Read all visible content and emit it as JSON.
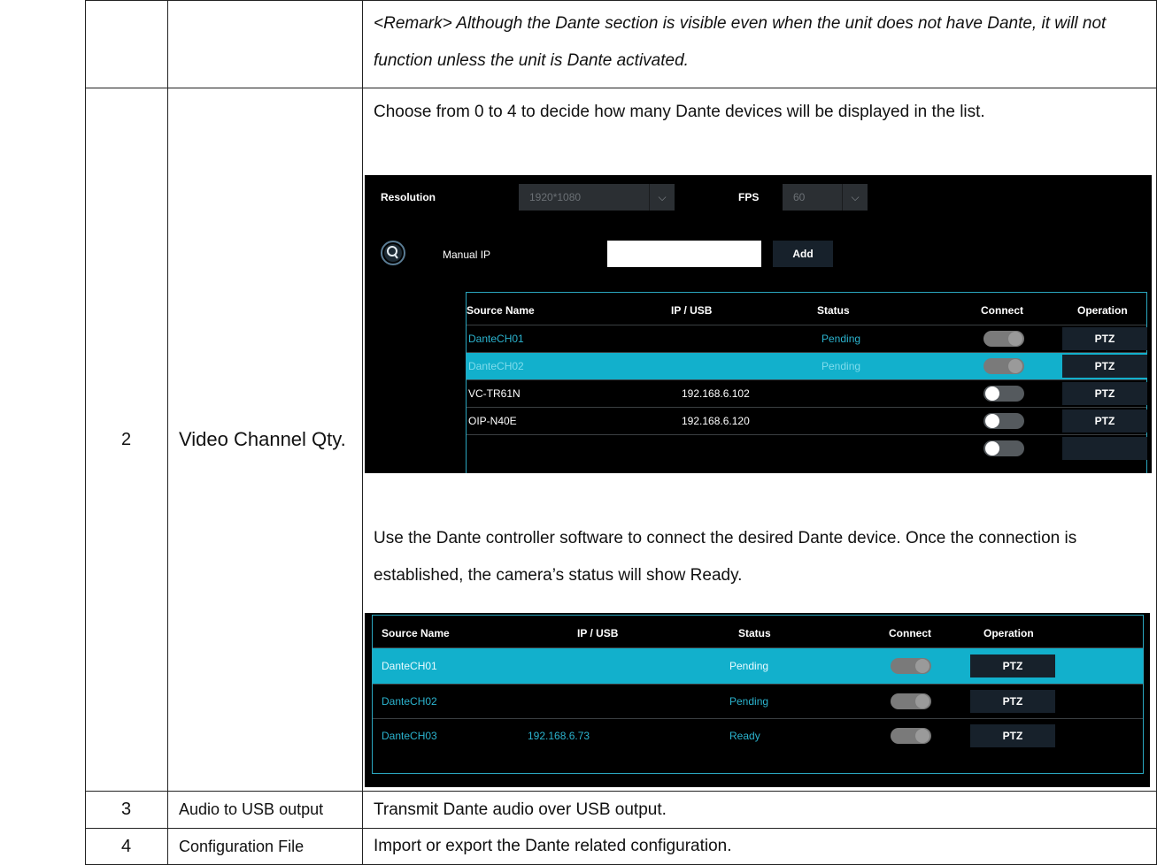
{
  "rows": [
    {
      "num": "",
      "name": "",
      "remark": "<Remark> Although the Dante section is visible even when the unit does not have Dante, it will not function unless the unit is Dante activated."
    },
    {
      "num": "2",
      "name": "Video Channel Qty.",
      "desc1": "Choose from 0 to 4 to decide how many Dante devices will be displayed in the list.",
      "desc2": "Use the Dante controller software to connect the desired Dante device. Once the connection is established, the camera’s status will show Ready."
    },
    {
      "num": "3",
      "name": "Audio to USB output",
      "desc": "Transmit Dante audio over USB output."
    },
    {
      "num": "4",
      "name": "Configuration File",
      "desc": "Import or export the Dante related configuration."
    }
  ],
  "shot1": {
    "resolution_label": "Resolution",
    "resolution_value": "1920*1080",
    "fps_label": "FPS",
    "fps_value": "60",
    "manual_ip_label": "Manual IP",
    "manual_ip_value": "",
    "add_label": "Add",
    "headers": [
      "Source Name",
      "IP / USB",
      "Status",
      "Connect",
      "Operation"
    ],
    "rows": [
      {
        "name": "DanteCH01",
        "ip": "",
        "status": "Pending",
        "op": "PTZ"
      },
      {
        "name": "DanteCH02",
        "ip": "",
        "status": "Pending",
        "op": "PTZ"
      },
      {
        "name": "VC-TR61N",
        "ip": "192.168.6.102",
        "status": "",
        "op": "PTZ"
      },
      {
        "name": "OIP-N40E",
        "ip": "192.168.6.120",
        "status": "",
        "op": "PTZ"
      }
    ]
  },
  "shot2": {
    "headers": [
      "Source Name",
      "IP / USB",
      "Status",
      "Connect",
      "Operation"
    ],
    "rows": [
      {
        "name": "DanteCH01",
        "ip": "",
        "status": "Pending",
        "op": "PTZ"
      },
      {
        "name": "DanteCH02",
        "ip": "",
        "status": "Pending",
        "op": "PTZ"
      },
      {
        "name": "DanteCH03",
        "ip": "192.168.6.73",
        "status": "Ready",
        "op": "PTZ"
      }
    ]
  },
  "icons": [
    "search-device-icon",
    "trash-icon"
  ],
  "colors": {
    "accent": "#12b0cc",
    "cyan_text": "#2bb3ce",
    "panel_bg": "#000000",
    "button_bg": "#17212b"
  }
}
